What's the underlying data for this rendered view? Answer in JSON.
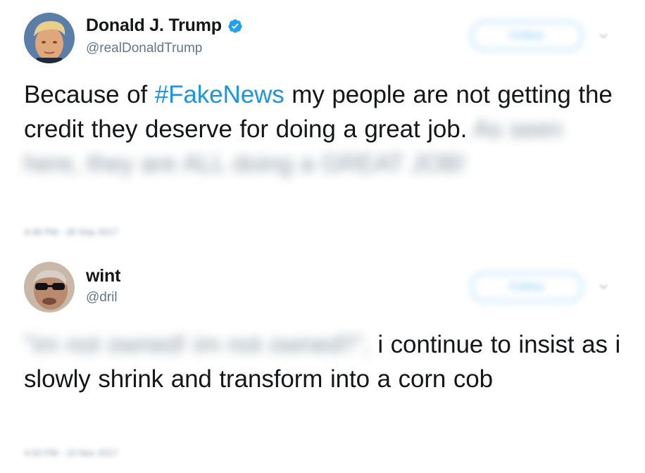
{
  "tweets": [
    {
      "display_name": "Donald J. Trump",
      "handle": "@realDonaldTrump",
      "verified": true,
      "follow_label": "Follow",
      "text_before": "Because of ",
      "hashtag": "#FakeNews",
      "text_after": " my people are not getting the credit they deserve for doing a great job.",
      "hidden_text": "As seen here, they are ALL doing a GREAT JOB!",
      "timestamp": "4:48 PM - 30 Sep 2017"
    },
    {
      "display_name": "wint",
      "handle": "@dril",
      "verified": false,
      "follow_label": "Follow",
      "hidden_text": "\"im not owned!  im not owned!!\",",
      "text_after": " i continue to insist as i slowly shrink and transform into a corn cob",
      "timestamp": "4:20 PM - 10 Nov 2017"
    }
  ],
  "colors": {
    "text": "#14171a",
    "secondary": "#657786",
    "link": "#1b95e0",
    "verified_badge": "#1da1f2"
  },
  "icons": {
    "verified": "verified-badge-icon",
    "more": "chevron-down-icon"
  }
}
